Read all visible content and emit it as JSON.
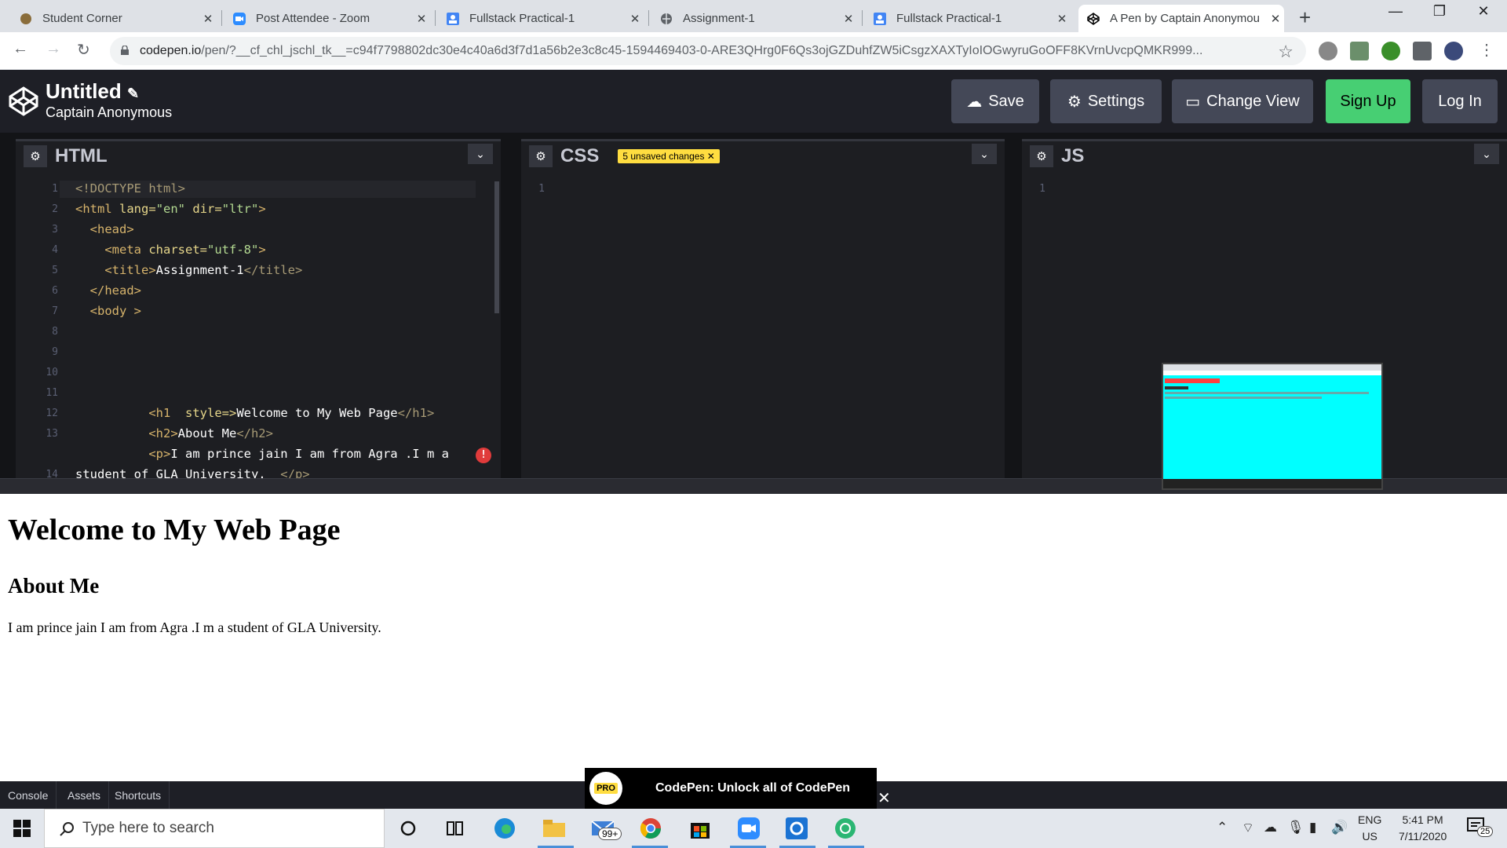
{
  "browser": {
    "tabs": [
      {
        "title": "Student Corner",
        "icon": "student-corner-favicon"
      },
      {
        "title": "Post Attendee - Zoom",
        "icon": "zoom-favicon"
      },
      {
        "title": "Fullstack Practical-1",
        "icon": "forms-favicon"
      },
      {
        "title": "Assignment-1",
        "icon": "globe-favicon"
      },
      {
        "title": "Fullstack Practical-1",
        "icon": "forms-favicon"
      },
      {
        "title": "A Pen by Captain Anonymou",
        "icon": "codepen-favicon"
      }
    ],
    "url_host": "codepen.io",
    "url_rest": "/pen/?__cf_chl_jschl_tk__=c94f7798802dc30e4c40a6d3f7d1a56b2e3c8c45-1594469403-0-ARE3QHrg0F6Qs3ojGZDuhfZW5iCsgzXAXTyIoIOGwyruGoOFF8KVrnUvcpQMKR999..."
  },
  "codepen": {
    "pen_title": "Untitled",
    "pen_author": "Captain Anonymous",
    "buttons": {
      "save": "Save",
      "settings": "Settings",
      "change_view": "Change View",
      "sign_up": "Sign Up",
      "log_in": "Log In"
    },
    "html_editor": {
      "title": "HTML"
    },
    "css_editor": {
      "title": "CSS",
      "badge": "5 unsaved changes"
    },
    "js_editor": {
      "title": "JS"
    },
    "line_numbers": [
      "1",
      "2",
      "3",
      "4",
      "5",
      "6",
      "7",
      "8",
      "9",
      "10",
      "11",
      "12",
      "13",
      "",
      "14"
    ],
    "empty_line_number": "1"
  },
  "preview": {
    "h1": "Welcome to My Web Page",
    "h2": "About Me",
    "p": "I am prince jain I am from Agra .I m a student of GLA University."
  },
  "bottom": {
    "console": "Console",
    "assets": "Assets",
    "shortcuts": "Shortcuts",
    "promo": "CodePen: Unlock all of CodePen",
    "pro": "PRO"
  },
  "taskbar": {
    "search_placeholder": "Type here to search",
    "lang_line1": "ENG",
    "lang_line2": "US",
    "time": "5:41 PM",
    "date": "7/11/2020",
    "mail_badge": "99+",
    "notif_count": "25"
  },
  "colors": {
    "codepen_bg": "#1e1f26",
    "accent_green": "#47cf73",
    "badge_yellow": "#ffdd40",
    "thumb_cyan": "#00ffff"
  }
}
